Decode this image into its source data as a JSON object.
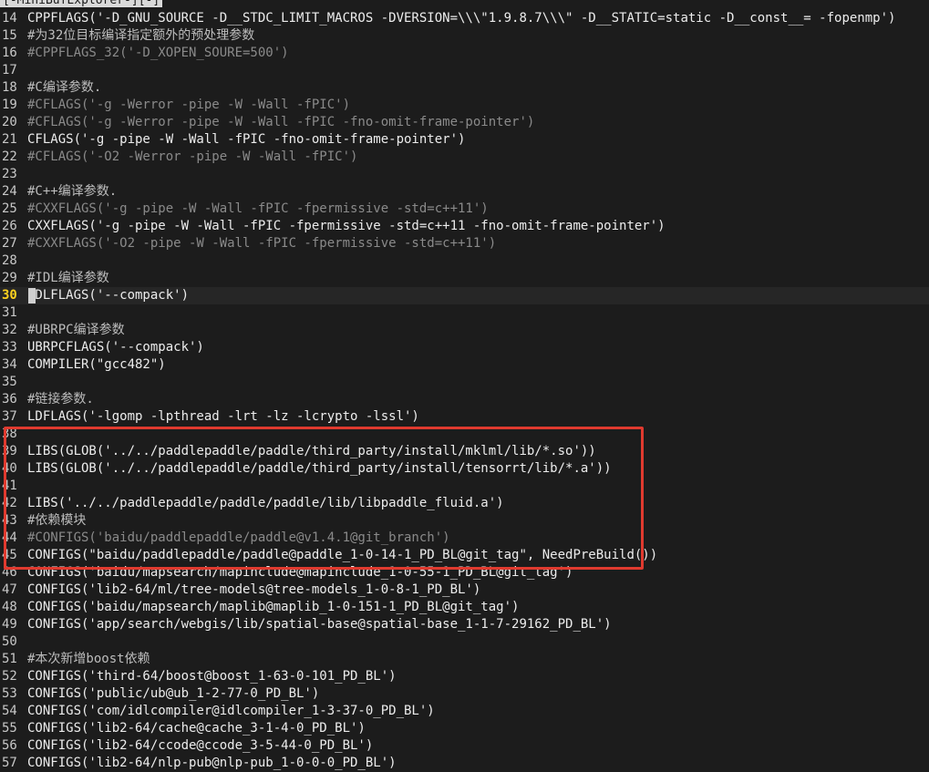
{
  "minibuf_title": "[-MiniBufExplorer-][-]",
  "cursor_line": 30,
  "highlight_color": "#e03a2f",
  "lines": [
    {
      "num": "14",
      "text": "CPPFLAGS('-D_GNU_SOURCE -D__STDC_LIMIT_MACROS -DVERSION=\\\\\\\"1.9.8.7\\\\\\\" -D__STATIC=static -D__const__= -fopenmp')",
      "kind": "plain"
    },
    {
      "num": "15",
      "text": "#为32位目标编译指定额外的预处理参数",
      "kind": "ccomment"
    },
    {
      "num": "16",
      "text": "#CPPFLAGS_32('-D_XOPEN_SOURE=500')",
      "kind": "comment"
    },
    {
      "num": "17",
      "text": "",
      "kind": "plain"
    },
    {
      "num": "18",
      "text": "#C编译参数.",
      "kind": "ccomment"
    },
    {
      "num": "19",
      "text": "#CFLAGS('-g -Werror -pipe -W -Wall -fPIC')",
      "kind": "comment"
    },
    {
      "num": "20",
      "text": "#CFLAGS('-g -Werror -pipe -W -Wall -fPIC -fno-omit-frame-pointer')",
      "kind": "comment"
    },
    {
      "num": "21",
      "text": "CFLAGS('-g -pipe -W -Wall -fPIC -fno-omit-frame-pointer')",
      "kind": "plain"
    },
    {
      "num": "22",
      "text": "#CFLAGS('-O2 -Werror -pipe -W -Wall -fPIC')",
      "kind": "comment"
    },
    {
      "num": "23",
      "text": "",
      "kind": "plain"
    },
    {
      "num": "24",
      "text": "#C++编译参数.",
      "kind": "ccomment"
    },
    {
      "num": "25",
      "text": "#CXXFLAGS('-g -pipe -W -Wall -fPIC -fpermissive -std=c++11')",
      "kind": "comment"
    },
    {
      "num": "26",
      "text": "CXXFLAGS('-g -pipe -W -Wall -fPIC -fpermissive -std=c++11 -fno-omit-frame-pointer')",
      "kind": "plain"
    },
    {
      "num": "27",
      "text": "#CXXFLAGS('-O2 -pipe -W -Wall -fPIC -fpermissive -std=c++11')",
      "kind": "comment"
    },
    {
      "num": "28",
      "text": "",
      "kind": "plain"
    },
    {
      "num": "29",
      "text": "#IDL编译参数",
      "kind": "ccomment"
    },
    {
      "num": "30",
      "text": "IDLFLAGS('--compack')",
      "kind": "plain"
    },
    {
      "num": "31",
      "text": "",
      "kind": "plain"
    },
    {
      "num": "32",
      "text": "#UBRPC编译参数",
      "kind": "ccomment"
    },
    {
      "num": "33",
      "text": "UBRPCFLAGS('--compack')",
      "kind": "plain"
    },
    {
      "num": "34",
      "text": "COMPILER(\"gcc482\")",
      "kind": "plain"
    },
    {
      "num": "35",
      "text": "",
      "kind": "plain"
    },
    {
      "num": "36",
      "text": "#链接参数.",
      "kind": "ccomment"
    },
    {
      "num": "37",
      "text": "LDFLAGS('-lgomp -lpthread -lrt -lz -lcrypto -lssl')",
      "kind": "plain"
    },
    {
      "num": "38",
      "text": "",
      "kind": "plain"
    },
    {
      "num": "39",
      "text": "LIBS(GLOB('../../paddlepaddle/paddle/third_party/install/mklml/lib/*.so'))",
      "kind": "plain"
    },
    {
      "num": "40",
      "text": "LIBS(GLOB('../../paddlepaddle/paddle/third_party/install/tensorrt/lib/*.a'))",
      "kind": "plain"
    },
    {
      "num": "41",
      "text": "",
      "kind": "plain"
    },
    {
      "num": "42",
      "text": "LIBS('../../paddlepaddle/paddle/paddle/lib/libpaddle_fluid.a')",
      "kind": "plain"
    },
    {
      "num": "43",
      "text": "#依赖模块",
      "kind": "ccomment"
    },
    {
      "num": "44",
      "text": "#CONFIGS('baidu/paddlepaddle/paddle@v1.4.1@git_branch')",
      "kind": "comment"
    },
    {
      "num": "45",
      "text": "CONFIGS(\"baidu/paddlepaddle/paddle@paddle_1-0-14-1_PD_BL@git_tag\", NeedPreBuild())",
      "kind": "plain"
    },
    {
      "num": "46",
      "text": "CONFIGS('baidu/mapsearch/mapinclude@mapinclude_1-0-55-1_PD_BL@git_tag')",
      "kind": "plain"
    },
    {
      "num": "47",
      "text": "CONFIGS('lib2-64/ml/tree-models@tree-models_1-0-8-1_PD_BL')",
      "kind": "plain"
    },
    {
      "num": "48",
      "text": "CONFIGS('baidu/mapsearch/maplib@maplib_1-0-151-1_PD_BL@git_tag')",
      "kind": "plain"
    },
    {
      "num": "49",
      "text": "CONFIGS('app/search/webgis/lib/spatial-base@spatial-base_1-1-7-29162_PD_BL')",
      "kind": "plain"
    },
    {
      "num": "50",
      "text": "",
      "kind": "plain"
    },
    {
      "num": "51",
      "text": "#本次新增boost依赖",
      "kind": "ccomment"
    },
    {
      "num": "52",
      "text": "CONFIGS('third-64/boost@boost_1-63-0-101_PD_BL')",
      "kind": "plain"
    },
    {
      "num": "53",
      "text": "CONFIGS('public/ub@ub_1-2-77-0_PD_BL')",
      "kind": "plain"
    },
    {
      "num": "54",
      "text": "CONFIGS('com/idlcompiler@idlcompiler_1-3-37-0_PD_BL')",
      "kind": "plain"
    },
    {
      "num": "55",
      "text": "CONFIGS('lib2-64/cache@cache_3-1-4-0_PD_BL')",
      "kind": "plain"
    },
    {
      "num": "56",
      "text": "CONFIGS('lib2-64/ccode@ccode_3-5-44-0_PD_BL')",
      "kind": "plain"
    },
    {
      "num": "57",
      "text": "CONFIGS('lib2-64/nlp-pub@nlp-pub_1-0-0-0_PD_BL')",
      "kind": "plain"
    }
  ]
}
